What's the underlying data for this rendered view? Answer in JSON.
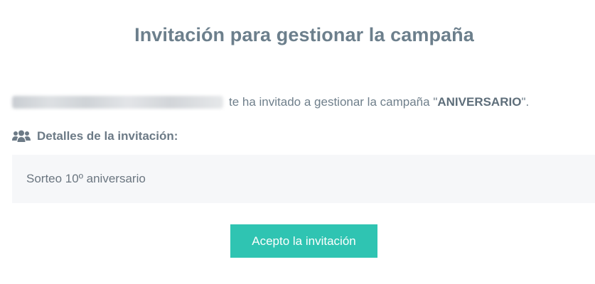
{
  "header": {
    "title": "Invitación para gestionar la campaña"
  },
  "invitation": {
    "message_prefix": "te ha invitado a gestionar la campaña ",
    "quote_open": "\"",
    "campaign_name": "ANIVERSARIO",
    "quote_close": "\".",
    "inviter_blurred": true
  },
  "details": {
    "icon": "users-icon",
    "header_label": "Detalles de la invitación:",
    "text": "Sorteo 10º aniversario"
  },
  "actions": {
    "accept_label": "Acepto la invitación"
  },
  "colors": {
    "accent": "#2fc4b2",
    "title": "#6c7f8c",
    "body_text": "#6f7f8b",
    "box_background": "#f6f7f9"
  }
}
